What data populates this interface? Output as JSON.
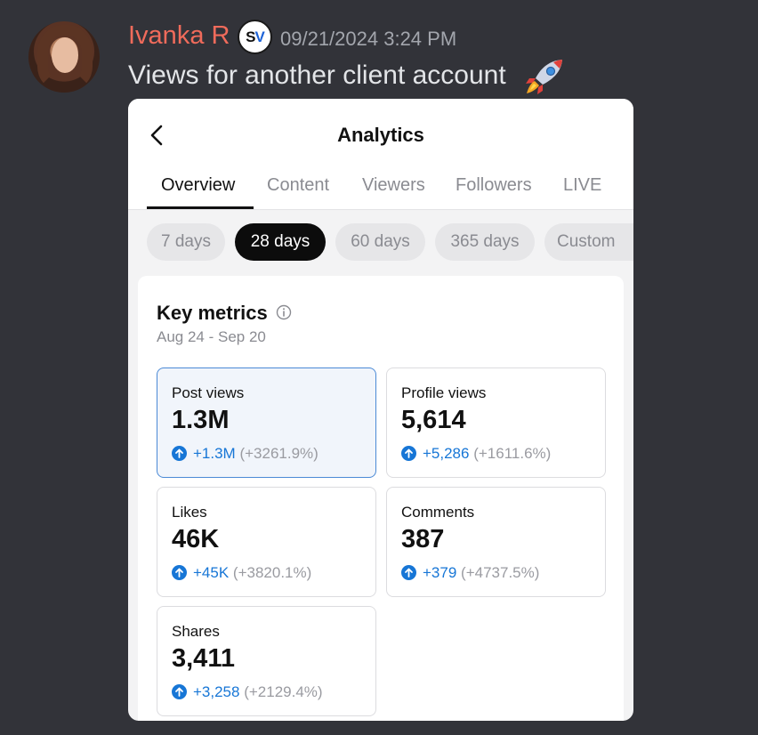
{
  "message": {
    "username": "Ivanka R",
    "badge": "SV",
    "timestamp": "09/21/2024 3:24 PM",
    "text": "Views for another client account",
    "emoji_icon": "rocket-icon"
  },
  "app": {
    "title": "Analytics",
    "back_icon": "chevron-left-icon",
    "tabs": [
      {
        "label": "Overview",
        "active": true
      },
      {
        "label": "Content",
        "active": false
      },
      {
        "label": "Viewers",
        "active": false
      },
      {
        "label": "Followers",
        "active": false
      },
      {
        "label": "LIVE",
        "active": false
      }
    ],
    "ranges": [
      {
        "label": "7 days",
        "active": false
      },
      {
        "label": "28 days",
        "active": true
      },
      {
        "label": "60 days",
        "active": false
      },
      {
        "label": "365 days",
        "active": false
      },
      {
        "label": "Custom",
        "active": false
      }
    ]
  },
  "key_metrics": {
    "title": "Key metrics",
    "date_range": "Aug 24 - Sep 20",
    "metrics": [
      {
        "label": "Post views",
        "value": "1.3M",
        "delta": "+1.3M",
        "pct": "(+3261.9%)"
      },
      {
        "label": "Profile views",
        "value": "5,614",
        "delta": "+5,286",
        "pct": "(+1611.6%)"
      },
      {
        "label": "Likes",
        "value": "46K",
        "delta": "+45K",
        "pct": "(+3820.1%)"
      },
      {
        "label": "Comments",
        "value": "387",
        "delta": "+379",
        "pct": "(+4737.5%)"
      },
      {
        "label": "Shares",
        "value": "3,411",
        "delta": "+3,258",
        "pct": "(+2129.4%)"
      }
    ]
  },
  "colors": {
    "background": "#323339",
    "username": "#f06b5b",
    "accent_blue": "#1776d6",
    "active_pill": "#0c0c0c"
  }
}
